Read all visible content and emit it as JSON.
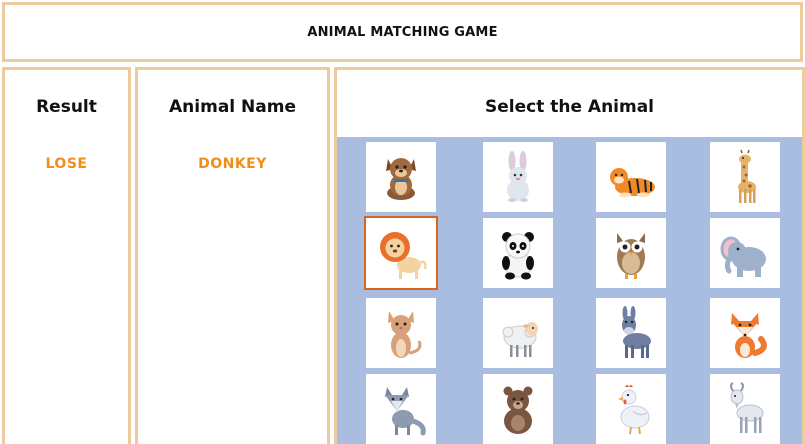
{
  "header": {
    "title": "ANIMAL MATCHING GAME"
  },
  "result": {
    "heading": "Result",
    "value": "LOSE"
  },
  "animal_name": {
    "heading": "Animal Name",
    "value": "DONKEY"
  },
  "select": {
    "heading": "Select the Animal"
  },
  "colors": {
    "panel_border": "#eccb9e",
    "accent_orange": "#f28d1b",
    "grid_background": "#a9bde1",
    "selected_border": "#d8641f"
  },
  "cards": [
    {
      "animal": "dog",
      "icon": "dog-icon",
      "selected": false
    },
    {
      "animal": "rabbit",
      "icon": "rabbit-icon",
      "selected": false
    },
    {
      "animal": "tiger",
      "icon": "tiger-icon",
      "selected": false
    },
    {
      "animal": "giraffe",
      "icon": "giraffe-icon",
      "selected": false
    },
    {
      "animal": "lion",
      "icon": "lion-icon",
      "selected": true
    },
    {
      "animal": "panda",
      "icon": "panda-icon",
      "selected": false
    },
    {
      "animal": "owl",
      "icon": "owl-icon",
      "selected": false
    },
    {
      "animal": "elephant",
      "icon": "elephant-icon",
      "selected": false
    },
    {
      "animal": "cat",
      "icon": "cat-icon",
      "selected": false
    },
    {
      "animal": "sheep",
      "icon": "sheep-icon",
      "selected": false
    },
    {
      "animal": "donkey",
      "icon": "donkey-icon",
      "selected": false
    },
    {
      "animal": "fox",
      "icon": "fox-icon",
      "selected": false
    },
    {
      "animal": "wolf",
      "icon": "wolf-icon",
      "selected": false
    },
    {
      "animal": "bear",
      "icon": "bear-icon",
      "selected": false
    },
    {
      "animal": "chicken",
      "icon": "chicken-icon",
      "selected": false
    },
    {
      "animal": "goat",
      "icon": "goat-icon",
      "selected": false
    }
  ]
}
